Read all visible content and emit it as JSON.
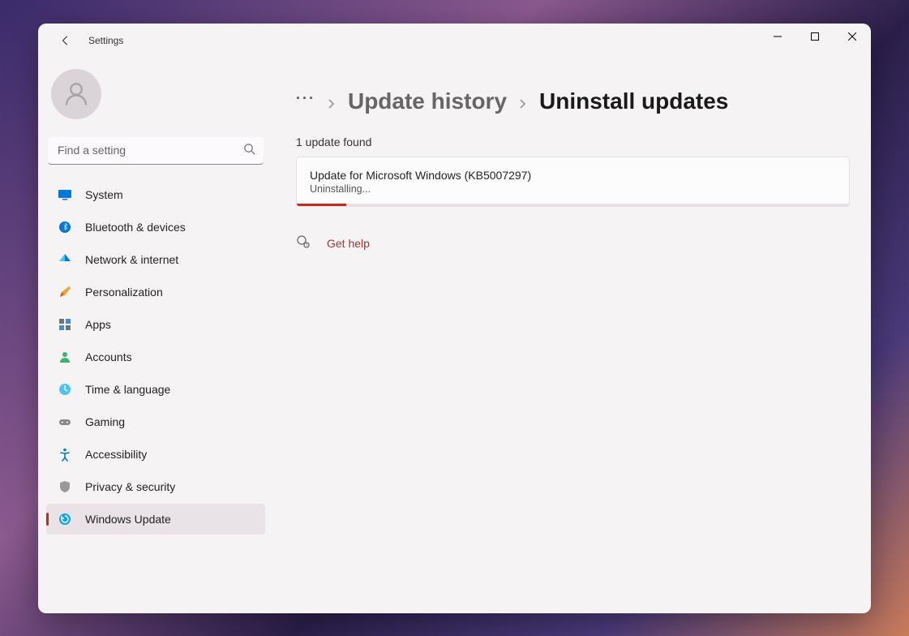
{
  "titlebar": {
    "title": "Settings"
  },
  "search": {
    "placeholder": "Find a setting"
  },
  "sidebar": {
    "items": [
      {
        "label": "System"
      },
      {
        "label": "Bluetooth & devices"
      },
      {
        "label": "Network & internet"
      },
      {
        "label": "Personalization"
      },
      {
        "label": "Apps"
      },
      {
        "label": "Accounts"
      },
      {
        "label": "Time & language"
      },
      {
        "label": "Gaming"
      },
      {
        "label": "Accessibility"
      },
      {
        "label": "Privacy & security"
      },
      {
        "label": "Windows Update"
      }
    ]
  },
  "breadcrumb": {
    "link": "Update history",
    "current": "Uninstall updates"
  },
  "main": {
    "count_label": "1 update found",
    "update": {
      "title": "Update for Microsoft Windows (KB5007297)",
      "status": "Uninstalling..."
    },
    "help_link": "Get help"
  }
}
